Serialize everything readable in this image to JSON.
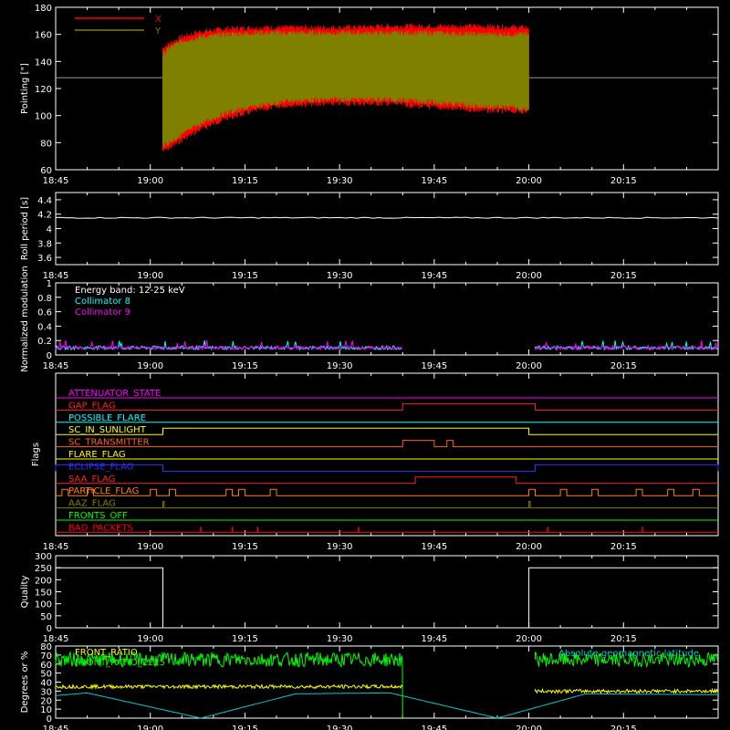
{
  "time_ticks": [
    "18:45",
    "19:00",
    "19:15",
    "19:30",
    "19:45",
    "20:00",
    "20:15"
  ],
  "chart_data": [
    {
      "id": "pointing",
      "type": "line",
      "ylabel": "Pointing [\"]",
      "ylim": [
        60,
        180
      ],
      "yticks": [
        60,
        80,
        100,
        120,
        140,
        160,
        180
      ],
      "reference_line": 128,
      "legend": {
        "placement": "top-left"
      },
      "series": [
        {
          "name": "X",
          "color": "#ff0000",
          "t": [
            "19:02",
            "19:03",
            "19:05",
            "19:08",
            "19:12",
            "19:17",
            "19:22",
            "19:30",
            "19:38",
            "19:45",
            "19:52",
            "20:00"
          ],
          "upper": [
            150,
            153,
            158,
            162,
            164,
            165,
            165,
            165,
            166,
            166,
            166,
            165
          ],
          "lower": [
            74,
            76,
            82,
            90,
            98,
            104,
            108,
            109,
            109,
            106,
            104,
            103
          ]
        },
        {
          "name": "Y",
          "color": "#808000",
          "t": [
            "19:02",
            "19:03",
            "19:05",
            "19:08",
            "19:12",
            "19:17",
            "19:22",
            "19:30",
            "19:38",
            "19:45",
            "19:52",
            "20:00"
          ],
          "upper": [
            145,
            150,
            155,
            158,
            160,
            161,
            161,
            161,
            161,
            161,
            160,
            160
          ],
          "lower": [
            78,
            80,
            86,
            94,
            102,
            107,
            111,
            112,
            112,
            110,
            107,
            105
          ]
        }
      ]
    },
    {
      "id": "roll",
      "type": "line",
      "ylabel": "Roll period [s]",
      "ylim": [
        3.5,
        4.5
      ],
      "yticks": [
        3.6,
        3.8,
        4.0,
        4.2,
        4.4
      ],
      "series": [
        {
          "name": "",
          "color": "#ffffff",
          "t": [
            "18:45",
            "20:30"
          ],
          "values": [
            4.15,
            4.15
          ]
        }
      ]
    },
    {
      "id": "modulation",
      "type": "line",
      "ylabel": "Normalized modulation",
      "ylim": [
        0,
        1.0
      ],
      "yticks": [
        0.0,
        0.2,
        0.4,
        0.6,
        0.8,
        1.0
      ],
      "annotations": [
        "Energy band: 12-25 keV"
      ],
      "series": [
        {
          "name": "Collimator 8",
          "color": "#00ffff",
          "level": 0.1,
          "segments": [
            [
              "18:45",
              "19:40"
            ],
            [
              "20:01",
              "20:30"
            ]
          ]
        },
        {
          "name": "Collimator 9",
          "color": "#ff00ff",
          "level": 0.1,
          "segments": [
            [
              "18:45",
              "19:40"
            ],
            [
              "20:01",
              "20:30"
            ]
          ]
        }
      ]
    },
    {
      "id": "flags",
      "type": "line",
      "ylabel": "Flags",
      "flags": [
        {
          "name": "ATTENUATOR_STATE",
          "color": "#ff00ff",
          "on": []
        },
        {
          "name": "GAP_FLAG",
          "color": "#ff2020",
          "on": [
            [
              "19:40",
              "20:01"
            ]
          ]
        },
        {
          "name": "POSSIBLE_FLARE",
          "color": "#00ffff",
          "on": []
        },
        {
          "name": "SC_IN_SUNLIGHT",
          "color": "#ffff00",
          "on": [
            [
              "19:02",
              "20:00"
            ]
          ]
        },
        {
          "name": "SC_TRANSMITTER",
          "color": "#ff6020",
          "on": [
            [
              "19:40",
              "19:45"
            ],
            [
              "19:47",
              "19:48"
            ]
          ]
        },
        {
          "name": "FLARE_FLAG",
          "color": "#ffff00",
          "on": []
        },
        {
          "name": "ECLIPSE_FLAG",
          "color": "#3030ff",
          "on": [
            [
              "18:45",
              "19:02"
            ],
            [
              "20:01",
              "20:30"
            ]
          ]
        },
        {
          "name": "SAA_FLAG",
          "color": "#ff2020",
          "on": [
            [
              "19:42",
              "19:58"
            ]
          ]
        },
        {
          "name": "PARTICLE_FLAG",
          "color": "#ff8000",
          "on": [
            [
              "18:46",
              "18:47"
            ],
            [
              "18:50",
              "18:51"
            ],
            [
              "19:00",
              "19:01"
            ],
            [
              "19:03",
              "19:04"
            ],
            [
              "19:12",
              "19:13"
            ],
            [
              "19:14",
              "19:15"
            ],
            [
              "19:19",
              "19:20"
            ],
            [
              "20:00",
              "20:01"
            ],
            [
              "20:05",
              "20:06"
            ],
            [
              "20:10",
              "20:11"
            ],
            [
              "20:17",
              "20:18"
            ],
            [
              "20:22",
              "20:23"
            ],
            [
              "20:26",
              "20:27"
            ]
          ]
        },
        {
          "name": "AAZ_FLAG",
          "color": "#808000",
          "on": [
            [
              "19:02",
              "19:02"
            ],
            [
              "20:00",
              "20:00"
            ]
          ]
        },
        {
          "name": "FRONTS_OFF",
          "color": "#00ff00",
          "on": []
        },
        {
          "name": "BAD_PACKETS",
          "color": "#ff0000",
          "spikes": [
            "19:08",
            "19:13",
            "19:17",
            "19:33",
            "20:03",
            "20:18"
          ]
        }
      ]
    },
    {
      "id": "quality",
      "type": "line",
      "ylabel": "Quality",
      "ylim": [
        0,
        300
      ],
      "yticks": [
        0,
        50,
        100,
        150,
        200,
        250,
        300
      ],
      "series": [
        {
          "name": "",
          "color": "#ffffff",
          "t": [
            "18:45",
            "19:02",
            "19:02",
            "20:00",
            "20:00",
            "20:30"
          ],
          "values": [
            250,
            250,
            0,
            0,
            250,
            250
          ]
        }
      ]
    },
    {
      "id": "ratios",
      "type": "line",
      "ylabel": "Degrees or %",
      "ylim": [
        0,
        80
      ],
      "yticks": [
        0,
        10,
        20,
        30,
        40,
        50,
        60,
        70,
        80
      ],
      "series": [
        {
          "name": "FRONT_RATIO",
          "color": "#ffff00",
          "level": 35,
          "segments": [
            [
              "18:45",
              "19:40"
            ],
            [
              "20:01",
              "20:30"
            ]
          ],
          "after_level": 30
        },
        {
          "name": "FRONT_RATIO_1225",
          "color": "#00ff00",
          "level": 65,
          "segments": [
            [
              "18:45",
              "19:40"
            ],
            [
              "20:01",
              "20:30"
            ]
          ]
        },
        {
          "name": "Absolute geomagnetic latitude",
          "color": "#00cccc",
          "t": [
            "18:45",
            "18:50",
            "19:08",
            "19:23",
            "19:38",
            "19:55",
            "20:09",
            "20:30"
          ],
          "values": [
            25,
            28,
            0,
            27,
            28,
            0,
            27,
            26
          ]
        }
      ]
    }
  ]
}
